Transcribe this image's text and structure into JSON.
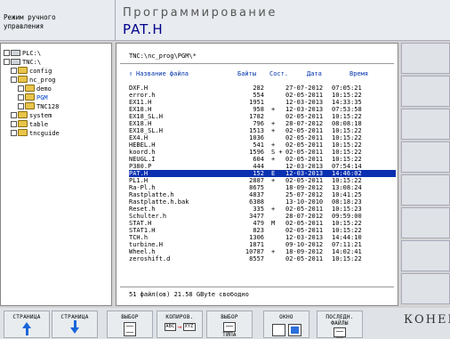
{
  "header": {
    "mode_text": "Режим ручного\nуправления",
    "program_title": "Программирование",
    "current_file": "PAT.H"
  },
  "tree": {
    "items": [
      {
        "label": "PLC:\\",
        "type": "drive",
        "indent": 0
      },
      {
        "label": "TNC:\\",
        "type": "drive",
        "indent": 0
      },
      {
        "label": "config",
        "type": "folder",
        "indent": 1
      },
      {
        "label": "nc_prog",
        "type": "folder",
        "indent": 1
      },
      {
        "label": "demo",
        "type": "folder",
        "indent": 2
      },
      {
        "label": "PGM",
        "type": "folder",
        "indent": 2,
        "selected": true
      },
      {
        "label": "TNC128",
        "type": "folder",
        "indent": 2
      },
      {
        "label": "system",
        "type": "folder",
        "indent": 1
      },
      {
        "label": "table",
        "type": "folder",
        "indent": 1
      },
      {
        "label": "tncguide",
        "type": "folder",
        "indent": 1
      }
    ]
  },
  "files": {
    "path": "TNC:\\nc_prog\\PGM\\*",
    "columns": {
      "name": "Название файла",
      "bytes": "Байты",
      "state": "Сост.",
      "date": "Дата",
      "time": "Время"
    },
    "rows": [
      {
        "name": "DXF.H",
        "bytes": "282",
        "state": "",
        "date": "27-07-2012",
        "time": "07:05:21"
      },
      {
        "name": "error.h",
        "bytes": "554",
        "state": "",
        "date": "02-05-2011",
        "time": "10:15:22"
      },
      {
        "name": "EX11.H",
        "bytes": "1951",
        "state": "",
        "date": "12-03-2013",
        "time": "14:33:35"
      },
      {
        "name": "EX18.H",
        "bytes": "958",
        "state": "+",
        "date": "12-03-2013",
        "time": "07:53:58"
      },
      {
        "name": "EX18_SL.H",
        "bytes": "1782",
        "state": "",
        "date": "02-05-2011",
        "time": "10:15:22"
      },
      {
        "name": "EX18.H",
        "bytes": "796",
        "state": "+",
        "date": "28-07-2012",
        "time": "08:08:18"
      },
      {
        "name": "EX18_SL.H",
        "bytes": "1513",
        "state": "+",
        "date": "02-05-2011",
        "time": "10:15:22"
      },
      {
        "name": "EX4.H",
        "bytes": "1036",
        "state": "",
        "date": "02-05-2011",
        "time": "10:15:22"
      },
      {
        "name": "HEBEL.H",
        "bytes": "541",
        "state": "+",
        "date": "02-05-2011",
        "time": "10:15:22"
      },
      {
        "name": "koord.h",
        "bytes": "1596",
        "state": "S +",
        "date": "02-05-2011",
        "time": "10:15:22"
      },
      {
        "name": "NEUGL.I",
        "bytes": "604",
        "state": "+",
        "date": "02-05-2011",
        "time": "10:15:22"
      },
      {
        "name": "P380.P",
        "bytes": "444",
        "state": "",
        "date": "12-03-2013",
        "time": "07:54:14"
      },
      {
        "name": "PAT.H",
        "bytes": "152",
        "state": "E",
        "date": "12-03-2013",
        "time": "14:46:02",
        "selected": true
      },
      {
        "name": "PL1.H",
        "bytes": "2887",
        "state": "+",
        "date": "02-05-2011",
        "time": "10:15:22"
      },
      {
        "name": "Ra-Pl.h",
        "bytes": "8675",
        "state": "",
        "date": "18-09-2012",
        "time": "13:08:24"
      },
      {
        "name": "Rastplatte.h",
        "bytes": "4837",
        "state": "",
        "date": "25-07-2012",
        "time": "10:41:25"
      },
      {
        "name": "Rastplatte.h.bak",
        "bytes": "6388",
        "state": "",
        "date": "13-10-2010",
        "time": "08:18:23"
      },
      {
        "name": "Reset.h",
        "bytes": "335",
        "state": "+",
        "date": "02-05-2011",
        "time": "10:15:23"
      },
      {
        "name": "Schulter.h",
        "bytes": "3477",
        "state": "",
        "date": "28-07-2012",
        "time": "09:59:00"
      },
      {
        "name": "STAT.H",
        "bytes": "479",
        "state": "M",
        "date": "02-05-2011",
        "time": "10:15:22"
      },
      {
        "name": "STAT1.H",
        "bytes": "823",
        "state": "",
        "date": "02-05-2011",
        "time": "10:15:22"
      },
      {
        "name": "TCH.h",
        "bytes": "1306",
        "state": "",
        "date": "12-03-2013",
        "time": "14:44:10"
      },
      {
        "name": "turbine.H",
        "bytes": "1871",
        "state": "",
        "date": "09-10-2012",
        "time": "07:11:21"
      },
      {
        "name": "Wheel.h",
        "bytes": "10787",
        "state": "+",
        "date": "18-09-2012",
        "time": "14:02:41"
      },
      {
        "name": "zeroshift.d",
        "bytes": "8557",
        "state": "",
        "date": "02-05-2011",
        "time": "10:15:22"
      }
    ],
    "footer": "51  файл(ов)  21.58 GByte свободно"
  },
  "softkeys": {
    "page_up": "СТРАНИЦА",
    "page_down": "СТРАНИЦА",
    "select": "ВЫБОР",
    "copy": "КОПИРОВ.",
    "copy_from": "ABC",
    "copy_to": "XYZ",
    "select_type": "ВЫБОР",
    "select_type_sub": "ТИПА",
    "window": "ОКНО",
    "last_files_1": "ПОСЛЕДН.",
    "last_files_2": "ФАЙЛЫ",
    "end": "КОНЕЦ"
  },
  "icons": {
    "page_up": "arrow-up-icon",
    "page_down": "arrow-down-icon",
    "select": "document-icon",
    "copy": "copy-icon",
    "select_type": "document-type-icon",
    "window": "window-split-icon",
    "last_files": "recent-files-icon",
    "tree_folder": "folder-icon",
    "tree_drive": "drive-icon"
  },
  "colors": {
    "selection": "#0a2fb0",
    "column_header": "#0033aa",
    "file_title": "#00008b",
    "arrow": "#1a66d9"
  }
}
